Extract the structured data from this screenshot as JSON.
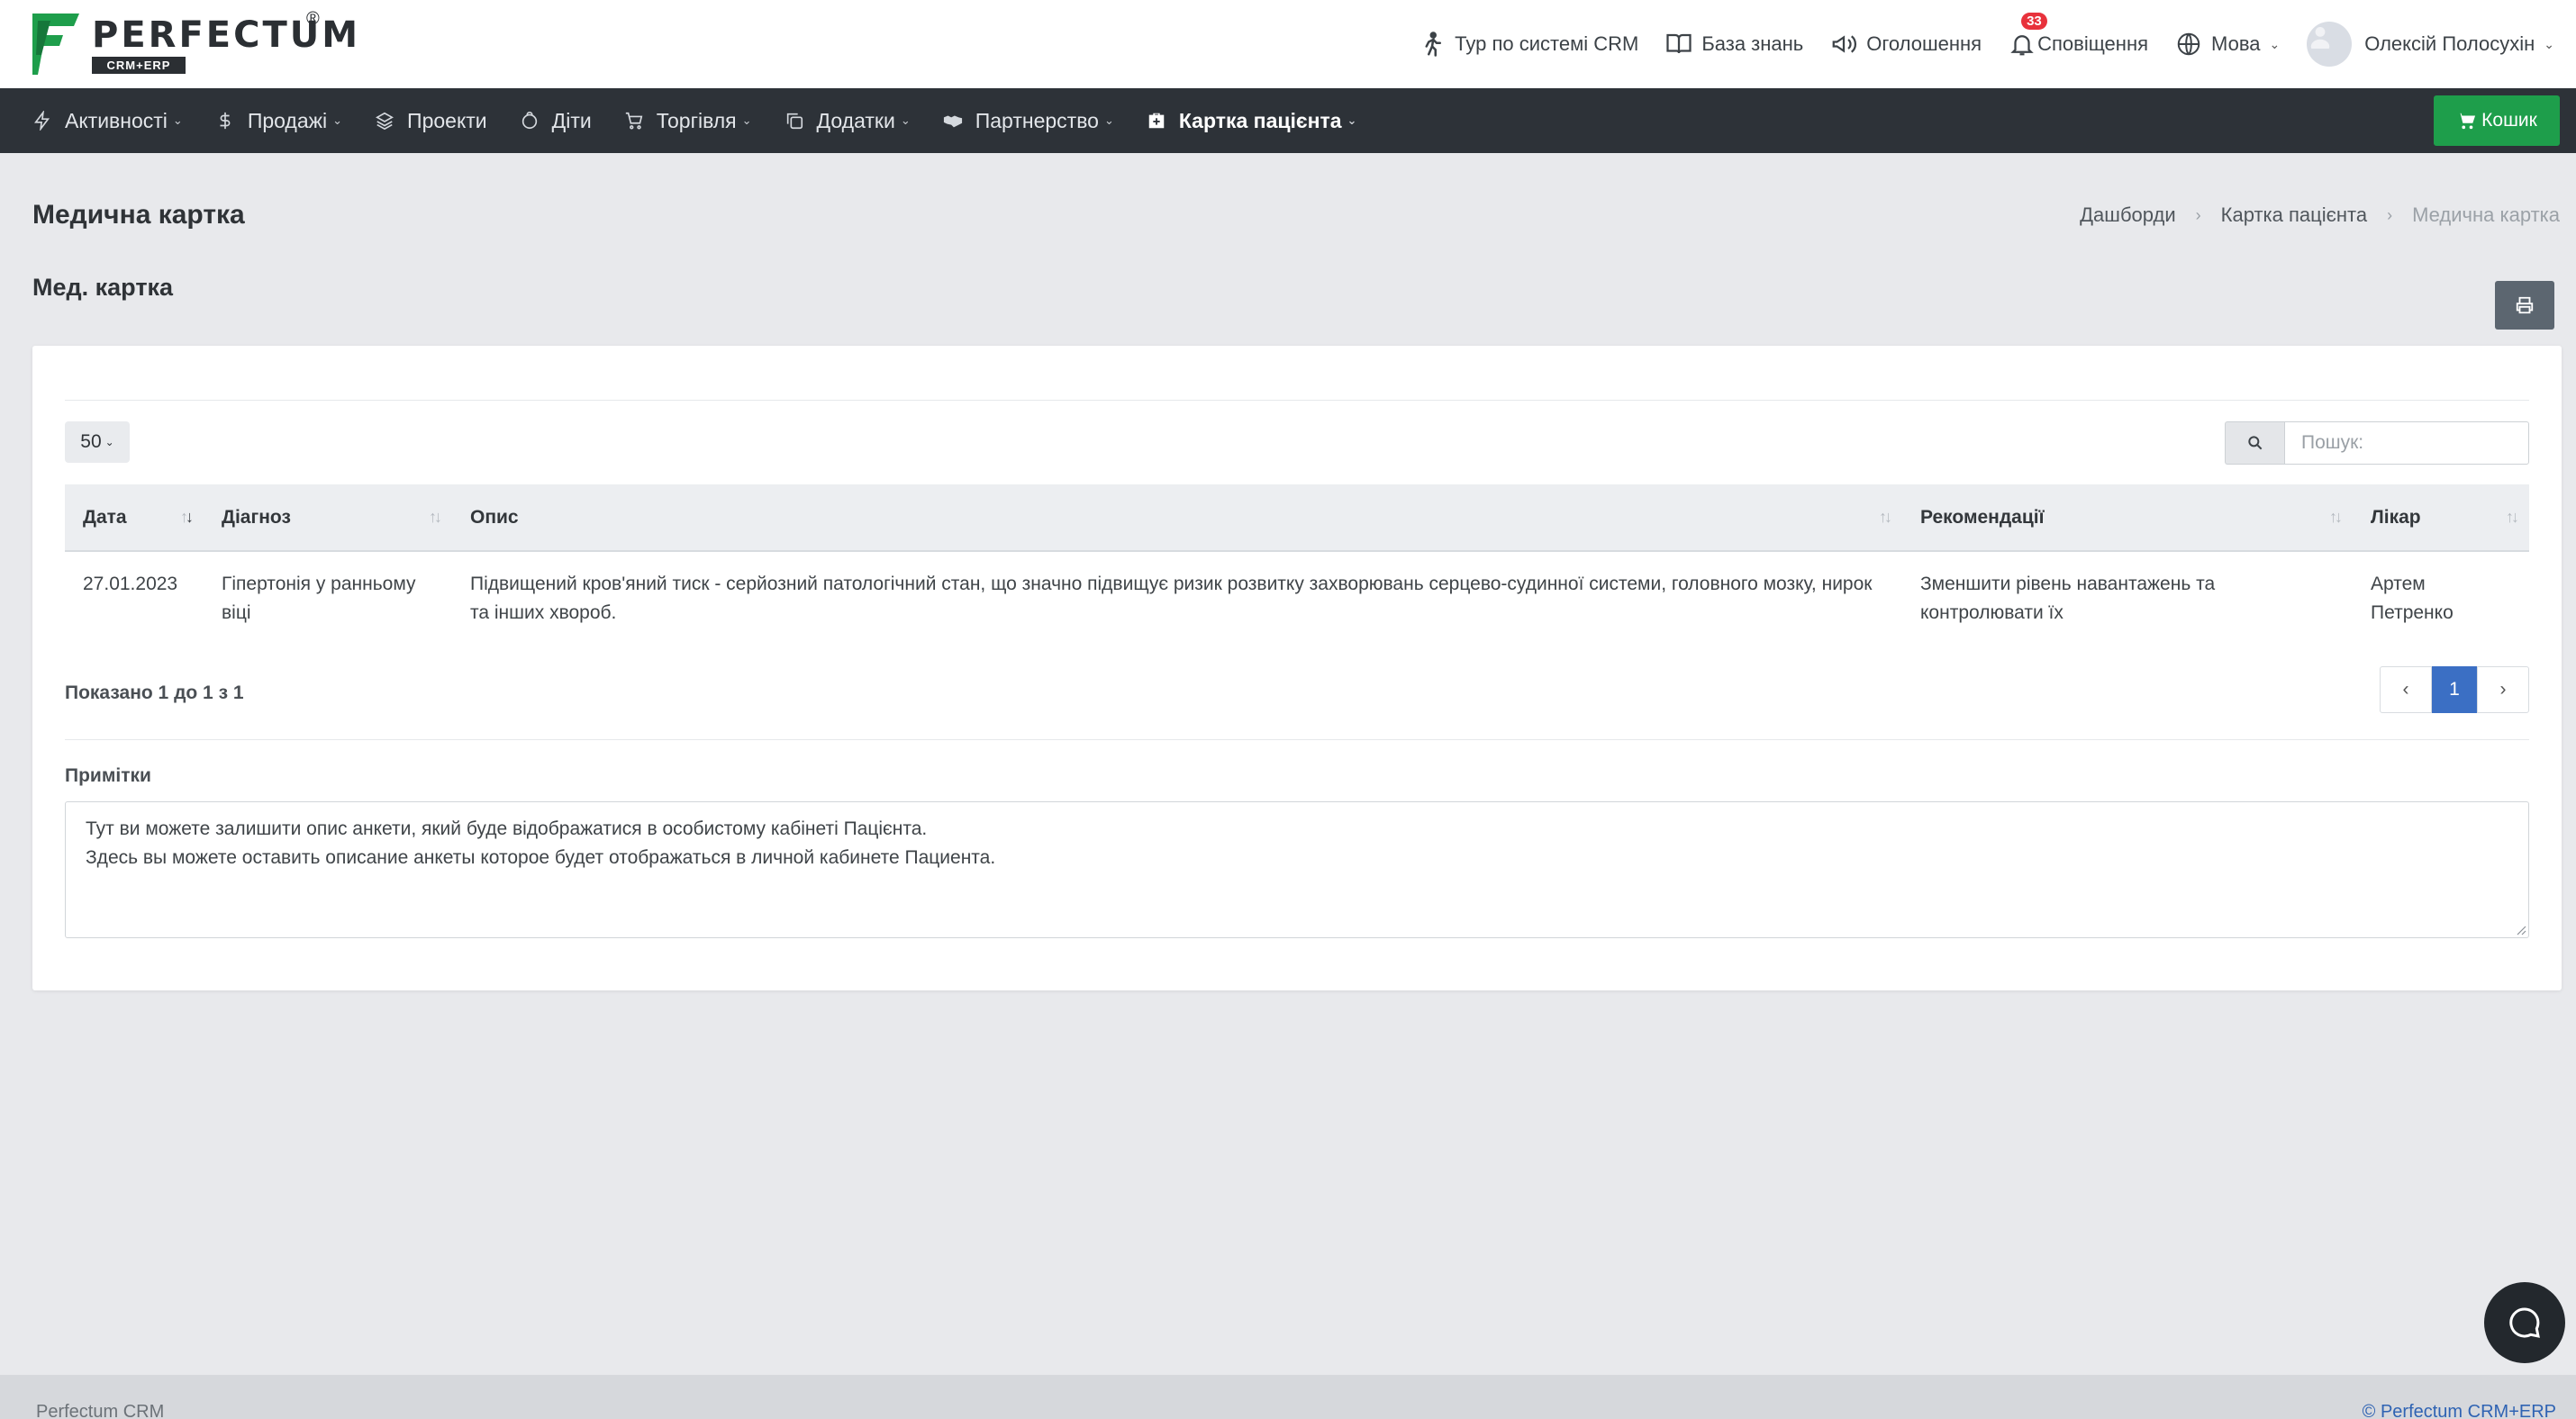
{
  "brand": {
    "name": "PERFECTUM",
    "subtitle": "CRM+ERP",
    "registered": "®",
    "mark_color": "#1e9e4b"
  },
  "header": {
    "tour": "Тур по системі CRM",
    "knowledge": "База знань",
    "announcements": "Оголошення",
    "notifications": "Сповіщення",
    "notifications_count": "33",
    "language": "Мова",
    "user_name": "Олексій Полосухін"
  },
  "nav": {
    "items": [
      {
        "label": "Активності",
        "icon": "bolt-icon"
      },
      {
        "label": "Продажі",
        "icon": "dollar-icon"
      },
      {
        "label": "Проекти",
        "icon": "layers-icon"
      },
      {
        "label": "Діти",
        "icon": "child-icon"
      },
      {
        "label": "Торгівля",
        "icon": "cart-icon"
      },
      {
        "label": "Додатки",
        "icon": "copy-icon"
      },
      {
        "label": "Партнерство",
        "icon": "handshake-icon"
      },
      {
        "label": "Картка пацієнта",
        "icon": "medkit-icon"
      }
    ],
    "cart_label": "Кошик",
    "cart_color": "#1e9e4b"
  },
  "page": {
    "title": "Медична картка",
    "breadcrumb": [
      "Дашборди",
      "Картка пацієнта",
      "Медична картка"
    ],
    "section_title": "Мед. картка"
  },
  "table": {
    "page_size": "50",
    "search_placeholder": "Пошук:",
    "columns": [
      "Дата",
      "Діагноз",
      "Опис",
      "Рекомендації",
      "Лікар"
    ],
    "rows": [
      {
        "date": "27.01.2023",
        "diagnosis": "Гіпертонія у ранньому віці",
        "description": "Підвищений кров'яний тиск - серйозний патологічний стан, що значно підвищує ризик розвитку захворювань серцево-судинної системи, головного мозку, нирок та інших хвороб.",
        "recommendations": "Зменшити рівень навантажень та контролювати їх",
        "doctor": "Артем Петренко"
      }
    ],
    "showing": "Показано 1 до 1 з 1",
    "current_page": "1",
    "pagination_color": "#3b6fc4"
  },
  "notes": {
    "label": "Примітки",
    "line1": "Тут ви можете залишити опис анкети, який буде відображатися в особистому кабінеті Пацієнта.",
    "line2": "Здесь вы можете оставить описание анкеты которое будет отображаться в личной кабинете Пациента."
  },
  "footer": {
    "left": "Perfectum CRM",
    "right": "© Perfectum CRM+ERP"
  }
}
